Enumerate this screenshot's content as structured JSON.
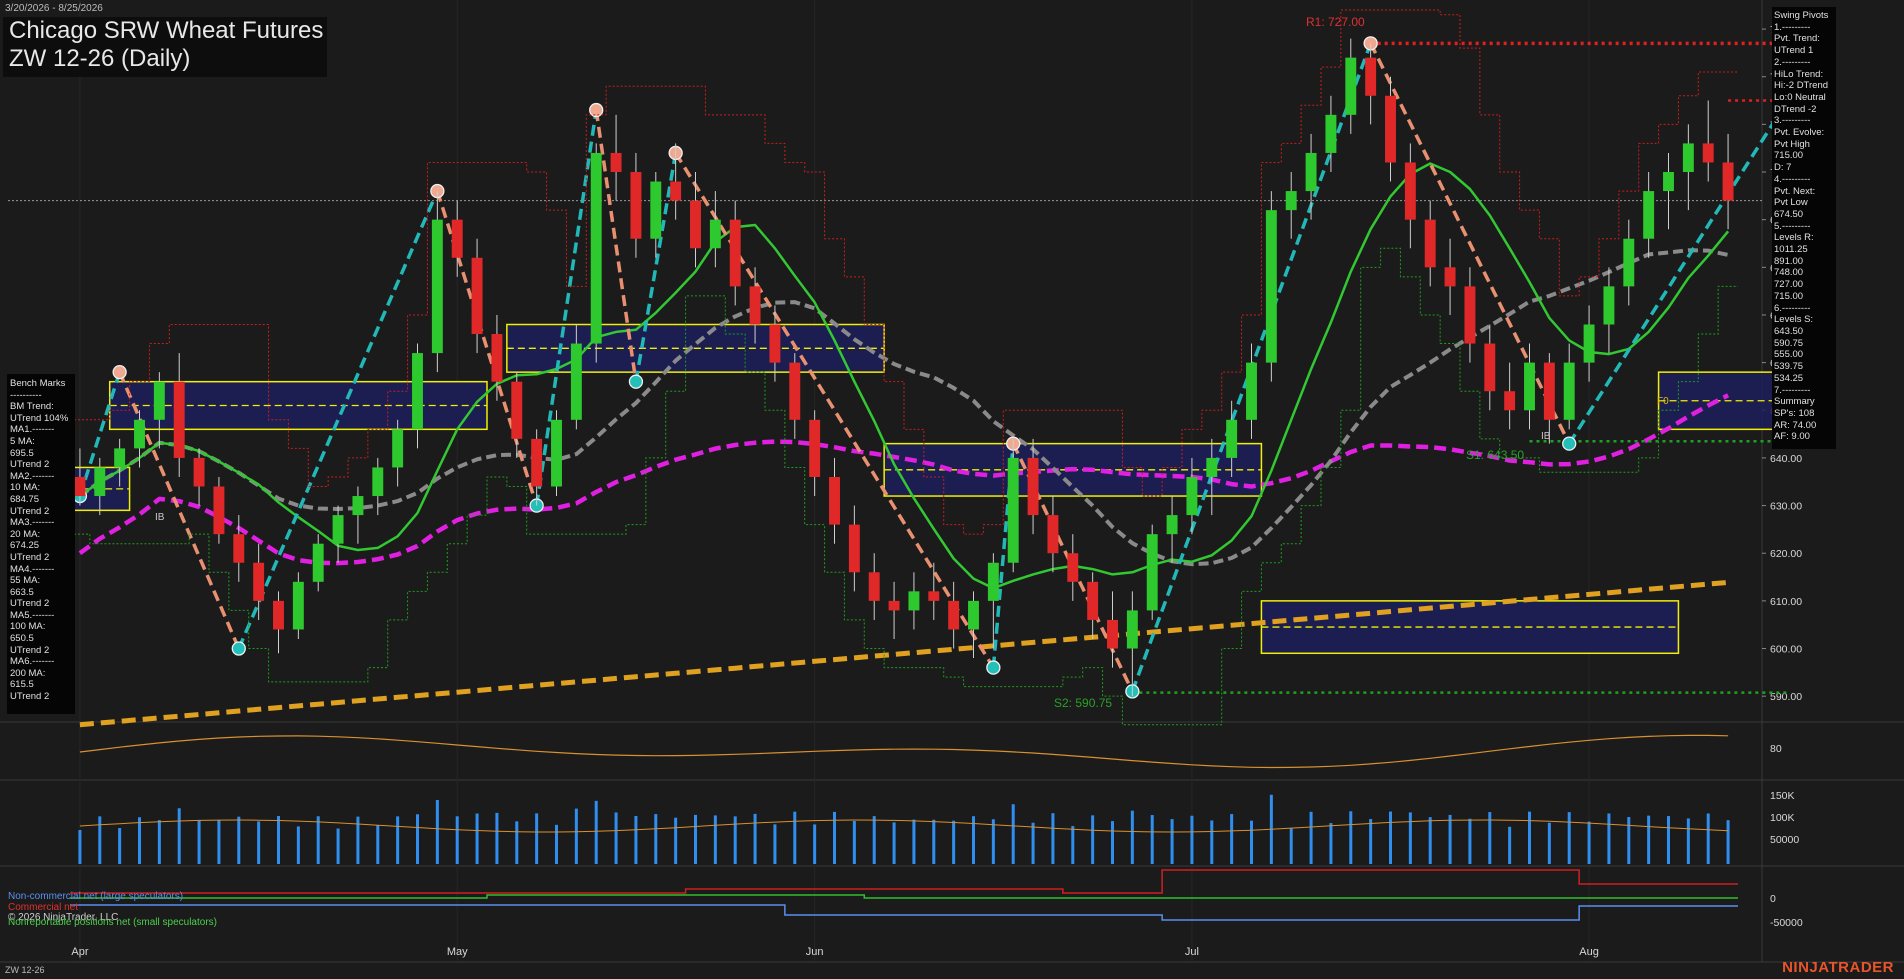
{
  "header": {
    "date_range": "3/20/2026 - 8/25/2026",
    "title": "Chicago SRW Wheat Futures",
    "subtitle": "ZW 12-26 (Daily)"
  },
  "footer": {
    "symbol": "ZW 12-26",
    "brand": "NINJATRADER",
    "copyright": "© 2026 NinjaTrader, LLC"
  },
  "bench_marks": [
    "Bench Marks",
    "----------",
    "BM Trend:",
    "UTrend 104%",
    "MA1.-------",
    "5 MA:",
    "695.5",
    "UTrend 2",
    "MA2.-------",
    "10 MA:",
    "684.75",
    "UTrend 2",
    "MA3.-------",
    "20 MA:",
    "674.25",
    "UTrend 2",
    "MA4.-------",
    "55 MA:",
    "663.5",
    "UTrend 2",
    "MA5.-------",
    "100 MA:",
    "650.5",
    "UTrend 2",
    "MA6.-------",
    "200 MA:",
    "615.5",
    "UTrend 2"
  ],
  "swing_pivots": [
    "Swing Pivots",
    "1.---------",
    "Pvt. Trend:",
    "UTrend 1",
    "2.---------",
    "HiLo Trend:",
    "Hi:-2 DTrend",
    "Lo:0 Neutral",
    "DTrend -2",
    "3.---------",
    "Pvt. Evolve:",
    "Pvt High",
    "715.00",
    "D: 7",
    "4.---------",
    "Pvt. Next:",
    "Pvt Low",
    "674.50",
    "5.---------",
    "Levels R:",
    "1011.25",
    "891.00",
    "748.00",
    "727.00",
    "715.00",
    "6.---------",
    "Levels S:",
    "643.50",
    "590.75",
    "555.00",
    "539.75",
    "534.25",
    "7.---------",
    "Summary",
    "SP's: 108",
    "AR: 74.00",
    "AF: 9.00"
  ],
  "annotations": {
    "r1": "R1: 727.00",
    "s1": "S1: 643.50",
    "s2": "S2: 590.75",
    "f0": "F0",
    "ib1": "IB",
    "ib2": "IB"
  },
  "legend": {
    "noncommercial": "Non-commercial net (large speculators)",
    "commercial": "Commercial net",
    "nonreportable": "Nonreportable positions net (small speculators)"
  },
  "colors": {
    "background": "#1b1b1b",
    "up_candle": "#2ec92e",
    "down_candle": "#e02828",
    "ma_green": "#32c832",
    "ma_gray": "#8a8a8a",
    "ma_magenta": "#e020e0",
    "ma_orange": "#e0a020",
    "zigzag_up": "#22b8b8",
    "zigzag_down": "#e89070",
    "resistance": "#e02020",
    "support": "#20a020",
    "box_fill": "#1c1f5c",
    "box_border": "#f0f000"
  },
  "chart_data": [
    {
      "type": "candlestick",
      "title": "Chicago SRW Wheat Futures",
      "price_ticks": [
        "590.00",
        "600.00",
        "610.00",
        "620.00",
        "630.00",
        "640.00",
        "650.00",
        "660.00",
        "670.00",
        "680.00",
        "690.00",
        "700.00",
        "710.00",
        "720.00",
        "730.00"
      ],
      "ylim": [
        585,
        734
      ],
      "month_labels": [
        "Apr",
        "May",
        "Jun",
        "Jul",
        "Aug"
      ],
      "month_ticks": [
        [
          0,
          "Apr"
        ],
        [
          19,
          "May"
        ],
        [
          37,
          "Jun"
        ],
        [
          56,
          "Jul"
        ],
        [
          76,
          "Aug"
        ]
      ],
      "ohlc": [
        [
          636,
          642,
          630,
          632
        ],
        [
          632,
          640,
          628,
          638
        ],
        [
          638,
          644,
          634,
          642
        ],
        [
          642,
          650,
          638,
          648
        ],
        [
          648,
          658,
          642,
          656
        ],
        [
          656,
          662,
          636,
          640
        ],
        [
          640,
          642,
          630,
          634
        ],
        [
          634,
          636,
          622,
          624
        ],
        [
          624,
          628,
          614,
          618
        ],
        [
          618,
          622,
          606,
          610
        ],
        [
          610,
          612,
          599,
          604
        ],
        [
          604,
          616,
          602,
          614
        ],
        [
          614,
          624,
          612,
          622
        ],
        [
          622,
          630,
          618,
          628
        ],
        [
          628,
          634,
          622,
          632
        ],
        [
          632,
          640,
          628,
          638
        ],
        [
          638,
          648,
          634,
          646
        ],
        [
          646,
          664,
          642,
          662
        ],
        [
          662,
          696,
          658,
          690
        ],
        [
          690,
          694,
          678,
          682
        ],
        [
          682,
          686,
          662,
          666
        ],
        [
          666,
          670,
          652,
          656
        ],
        [
          656,
          658,
          640,
          644
        ],
        [
          644,
          646,
          630,
          634
        ],
        [
          634,
          650,
          632,
          648
        ],
        [
          648,
          668,
          646,
          664
        ],
        [
          664,
          706,
          660,
          704
        ],
        [
          704,
          712,
          694,
          700
        ],
        [
          700,
          704,
          682,
          686
        ],
        [
          686,
          700,
          682,
          698
        ],
        [
          698,
          706,
          690,
          694
        ],
        [
          694,
          700,
          680,
          684
        ],
        [
          684,
          696,
          680,
          690
        ],
        [
          690,
          694,
          672,
          676
        ],
        [
          676,
          680,
          664,
          668
        ],
        [
          668,
          672,
          656,
          660
        ],
        [
          660,
          662,
          644,
          648
        ],
        [
          648,
          650,
          632,
          636
        ],
        [
          636,
          640,
          622,
          626
        ],
        [
          626,
          630,
          612,
          616
        ],
        [
          616,
          620,
          606,
          610
        ],
        [
          610,
          614,
          602,
          608
        ],
        [
          608,
          616,
          604,
          612
        ],
        [
          612,
          618,
          606,
          610
        ],
        [
          610,
          614,
          600,
          604
        ],
        [
          604,
          612,
          598,
          610
        ],
        [
          610,
          620,
          600,
          618
        ],
        [
          618,
          644,
          616,
          640
        ],
        [
          640,
          644,
          624,
          628
        ],
        [
          628,
          632,
          616,
          620
        ],
        [
          620,
          624,
          610,
          614
        ],
        [
          614,
          616,
          602,
          606
        ],
        [
          606,
          612,
          596,
          600
        ],
        [
          600,
          612,
          590,
          608
        ],
        [
          608,
          626,
          606,
          624
        ],
        [
          624,
          632,
          618,
          628
        ],
        [
          628,
          640,
          624,
          636
        ],
        [
          636,
          644,
          628,
          640
        ],
        [
          640,
          652,
          636,
          648
        ],
        [
          648,
          664,
          644,
          660
        ],
        [
          660,
          696,
          656,
          692
        ],
        [
          692,
          700,
          686,
          696
        ],
        [
          696,
          708,
          690,
          704
        ],
        [
          704,
          716,
          700,
          712
        ],
        [
          712,
          728,
          708,
          724
        ],
        [
          724,
          727,
          710,
          716
        ],
        [
          716,
          720,
          698,
          702
        ],
        [
          702,
          706,
          684,
          690
        ],
        [
          690,
          694,
          676,
          680
        ],
        [
          680,
          686,
          670,
          676
        ],
        [
          676,
          680,
          660,
          664
        ],
        [
          664,
          668,
          650,
          654
        ],
        [
          654,
          660,
          646,
          650
        ],
        [
          650,
          664,
          646,
          660
        ],
        [
          660,
          662,
          643,
          648
        ],
        [
          648,
          664,
          646,
          660
        ],
        [
          660,
          672,
          656,
          668
        ],
        [
          668,
          680,
          662,
          676
        ],
        [
          676,
          690,
          672,
          686
        ],
        [
          686,
          700,
          682,
          696
        ],
        [
          696,
          704,
          688,
          700
        ],
        [
          700,
          710,
          692,
          706
        ],
        [
          706,
          715,
          698,
          702
        ],
        [
          702,
          708,
          688,
          694
        ]
      ]
    },
    {
      "type": "line",
      "title": "",
      "ticks": [
        "80"
      ]
    },
    {
      "type": "bar",
      "title": "",
      "ticks": [
        "150K",
        "100K",
        "50000"
      ]
    },
    {
      "type": "line",
      "title": "",
      "ticks": [
        "0",
        "-50000"
      ]
    }
  ]
}
